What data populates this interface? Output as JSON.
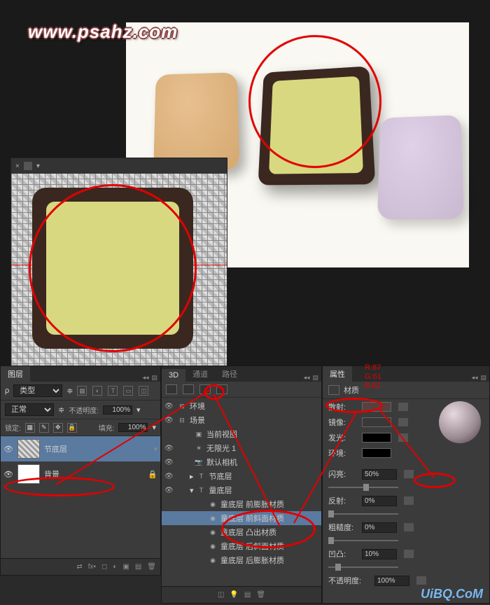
{
  "watermark": "www.psahz.com",
  "watermark2": "UiBQ.CoM",
  "rgb": {
    "r": "R:87",
    "g": "G:61",
    "b": "B:62"
  },
  "layers_panel": {
    "tab": "图层",
    "type_label": "类型",
    "blend_mode": "正常",
    "opacity_label": "不透明度:",
    "opacity_value": "100%",
    "lock_label": "锁定:",
    "fill_label": "填充:",
    "fill_value": "100%",
    "layers": [
      {
        "name": "节底层",
        "selected": true
      },
      {
        "name": "背景",
        "selected": false
      }
    ]
  },
  "d3_panel": {
    "tabs": [
      "3D",
      "通道",
      "路径"
    ],
    "items": [
      {
        "indent": 0,
        "icon": "env",
        "label": "环境"
      },
      {
        "indent": 0,
        "icon": "scene",
        "label": "场景"
      },
      {
        "indent": 1,
        "icon": "view",
        "label": "当前视图"
      },
      {
        "indent": 1,
        "icon": "light",
        "label": "无限光 1"
      },
      {
        "indent": 1,
        "icon": "cam",
        "label": "默认相机"
      },
      {
        "indent": 1,
        "icon": "mesh",
        "label": "节底层"
      },
      {
        "indent": 1,
        "icon": "mesh",
        "label": "童底层",
        "expanded": true
      },
      {
        "indent": 2,
        "icon": "mat",
        "label": "童底层 前膨胀材质"
      },
      {
        "indent": 2,
        "icon": "mat",
        "label": "童底层 前斜面材质",
        "selected": true
      },
      {
        "indent": 2,
        "icon": "mat",
        "label": "童底层 凸出材质"
      },
      {
        "indent": 2,
        "icon": "mat",
        "label": "童底层 后斜面材质"
      },
      {
        "indent": 2,
        "icon": "mat",
        "label": "童底层 后膨胀材质"
      }
    ]
  },
  "props_panel": {
    "tab": "属性",
    "header": "材质",
    "rows": {
      "diffuse": "散射:",
      "specular": "镜像:",
      "illumination": "发光:",
      "ambient": "环境:",
      "shine": "闪亮:",
      "shine_val": "50%",
      "reflection": "反射:",
      "reflection_val": "0%",
      "roughness": "粗糙度:",
      "roughness_val": "0%",
      "bump": "凹凸:",
      "bump_val": "10%",
      "opacity": "不透明度:",
      "opacity_val": "100%"
    }
  }
}
